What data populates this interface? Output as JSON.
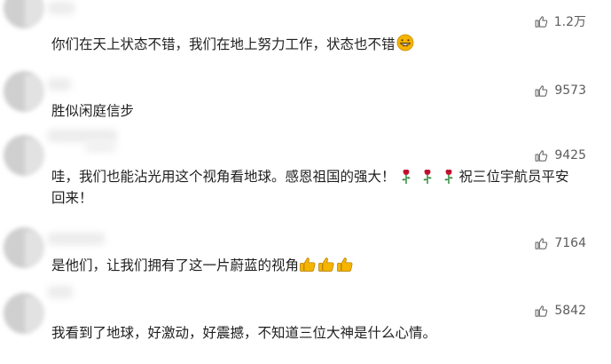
{
  "comments": [
    {
      "text": "你们在天上状态不错，我们在地上努力工作，状态也不错",
      "likes": "1.2万",
      "trailing_emoji": "grinning-face-icon"
    },
    {
      "text": "胜似闲庭信步",
      "likes": "9573"
    },
    {
      "text_line1_a": "哇，我们也能沾光用这个视角看地球。感恩祖国的强大！",
      "text_line1_b": "祝三位宇航员平安",
      "text_line2": "回来！",
      "likes": "9425",
      "inline_emoji": "rose-icon",
      "inline_emoji_count": 3
    },
    {
      "text": "是他们，让我们拥有了这一片蔚蓝的视角",
      "likes": "7164",
      "trailing_emoji": "thumbs-up-icon",
      "trailing_emoji_count": 3
    },
    {
      "text": "我看到了地球，好激动，好震撼，不知道三位大神是什么心情。",
      "likes": "5842"
    }
  ],
  "colors": {
    "text": "#1f1f1f",
    "like_text": "#5c5c5c",
    "emoji_yellow": "#f5b400",
    "rose_red": "#c8102e",
    "rose_green": "#2e8b3a"
  }
}
